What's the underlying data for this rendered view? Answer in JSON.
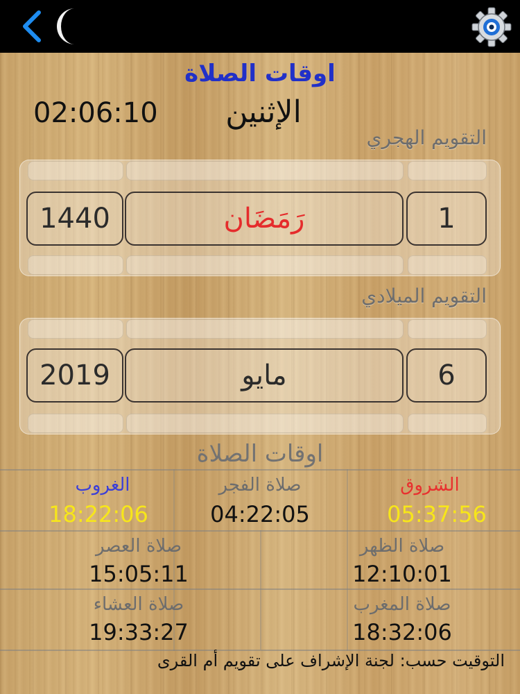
{
  "app": {
    "title": "اوقات الصلاة",
    "weekday": "الإثنين",
    "clock": "02:06:10"
  },
  "hijri": {
    "label": "التقويم الهجري",
    "day": "1",
    "month": "رَمَضَان",
    "year": "1440"
  },
  "gregorian": {
    "label": "التقويم الميلادي",
    "day": "6",
    "month": "مايو",
    "year": "2019"
  },
  "prayers": {
    "section_title": "اوقات الصلاة",
    "sunrise": {
      "name": "الشروق",
      "time": "05:37:56"
    },
    "fajr": {
      "name": "صلاة الفجر",
      "time": "04:22:05"
    },
    "sunset": {
      "name": "الغروب",
      "time": "18:22:06"
    },
    "dhuhr": {
      "name": "صلاة الظهر",
      "time": "12:10:01"
    },
    "asr": {
      "name": "صلاة العصر",
      "time": "15:05:11"
    },
    "maghrib": {
      "name": "صلاة المغرب",
      "time": "18:32:06"
    },
    "isha": {
      "name": "صلاة العشاء",
      "time": "19:33:27"
    }
  },
  "footer": {
    "note": "التوقيت حسب: لجنة الإشراف على تقويم أم القرى"
  },
  "colors": {
    "title_blue": "#2130c8",
    "hijri_month_red": "#e52c2c",
    "sunrise_red": "#e8312f",
    "sunset_blue": "#3b3fd8",
    "highlight_yellow": "#f7e61a"
  },
  "icons": {
    "back": "chevron-left-icon",
    "moon": "crescent-moon-icon",
    "settings": "gear-icon"
  }
}
